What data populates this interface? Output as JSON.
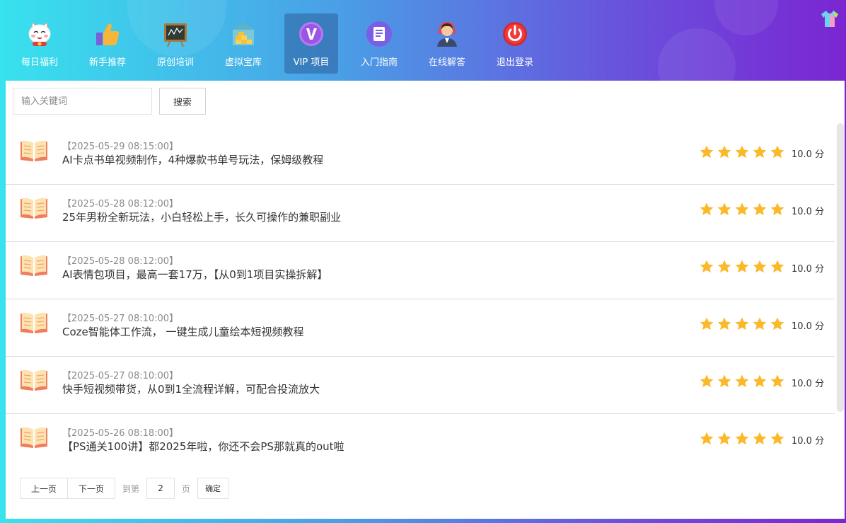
{
  "nav": {
    "items": [
      {
        "label": "每日福利",
        "icon": "lucky-cat-icon",
        "active": false
      },
      {
        "label": "新手推荐",
        "icon": "thumbs-up-icon",
        "active": false
      },
      {
        "label": "原创培训",
        "icon": "blackboard-icon",
        "active": false
      },
      {
        "label": "虚拟宝库",
        "icon": "treasure-vault-icon",
        "active": false
      },
      {
        "label": "VIP 项目",
        "icon": "vip-icon",
        "active": true
      },
      {
        "label": "入门指南",
        "icon": "guide-document-icon",
        "active": false
      },
      {
        "label": "在线解答",
        "icon": "support-agent-icon",
        "active": false
      },
      {
        "label": "退出登录",
        "icon": "power-icon",
        "active": false
      }
    ]
  },
  "search": {
    "placeholder": "输入关键词",
    "value": "",
    "button": "搜索"
  },
  "list": [
    {
      "date": "【2025-05-29 08:15:00】",
      "title": "AI卡点书单视频制作，4种爆款书单号玩法，保姆级教程",
      "rating": 5,
      "score": "10.0 分"
    },
    {
      "date": "【2025-05-28 08:12:00】",
      "title": "25年男粉全新玩法，小白轻松上手，长久可操作的兼职副业",
      "rating": 5,
      "score": "10.0 分"
    },
    {
      "date": "【2025-05-28 08:12:00】",
      "title": "AI表情包项目，最高一套17万，【从0到1项目实操拆解】",
      "rating": 5,
      "score": "10.0 分"
    },
    {
      "date": "【2025-05-27 08:10:00】",
      "title": "Coze智能体工作流， 一键生成儿童绘本短视频教程",
      "rating": 5,
      "score": "10.0 分"
    },
    {
      "date": "【2025-05-27 08:10:00】",
      "title": "快手短视频带货，从0到1全流程详解，可配合投流放大",
      "rating": 5,
      "score": "10.0 分"
    },
    {
      "date": "【2025-05-26 08:18:00】",
      "title": "【PS通关100讲】都2025年啦，你还不会PS那就真的out啦",
      "rating": 5,
      "score": "10.0 分"
    }
  ],
  "pager": {
    "prev": "上一页",
    "next": "下一页",
    "goto": "到第",
    "page": "2",
    "unit": "页",
    "confirm": "确定"
  },
  "colors": {
    "star": "#fbb829",
    "book": "#f07d5e"
  }
}
